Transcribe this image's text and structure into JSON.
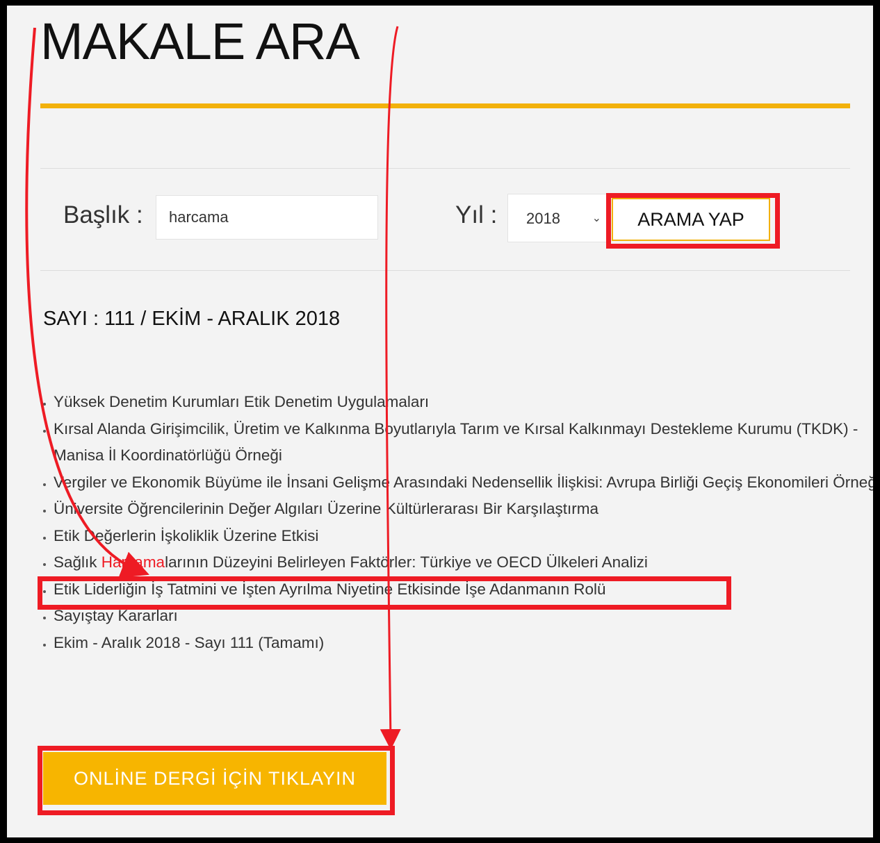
{
  "page_title": "MAKALE ARA",
  "search": {
    "title_label": "Başlık :",
    "title_value": "harcama",
    "year_label": "Yıl :",
    "year_value": "2018",
    "button_label": "ARAMA YAP"
  },
  "issue_heading": "SAYI : 111 / EKİM - ARALIK 2018",
  "articles": [
    "Yüksek Denetim Kurumları Etik Denetim Uygulamaları",
    "Kırsal Alanda Girişimcilik, Üretim ve Kalkınma Boyutlarıyla Tarım ve Kırsal Kalkınmayı Destekleme Kurumu (TKDK) - Manisa İl Koordinatörlüğü Örneği",
    "Vergiler ve Ekonomik Büyüme ile İnsani Gelişme Arasındaki Nedensellik İlişkisi: Avrupa Birliği Geçiş Ekonomileri Örneği",
    "Üniversite Öğrencilerinin Değer Algıları Üzerine Kültürlerarası Bir Karşılaştırma",
    "Etik Değerlerin İşkoliklik Üzerine Etkisi",
    {
      "prefix": "Sağlık ",
      "highlight": "Harcama",
      "suffix": "larının Düzeyini Belirleyen Faktörler: Türkiye ve OECD Ülkeleri Analizi"
    },
    "Etik Liderliğin İş Tatmini ve İşten Ayrılma Niyetine Etkisinde İşe Adanmanın Rolü",
    "Sayıştay Kararları",
    "Ekim - Aralık 2018 - Sayı 111 (Tamamı)"
  ],
  "online_button_label": "ONLİNE DERGİ İÇİN TIKLAYIN",
  "colors": {
    "accent": "#f2b10c",
    "button": "#f7b500",
    "annotation_red": "#ee1b24",
    "background": "#f3f3f3"
  }
}
